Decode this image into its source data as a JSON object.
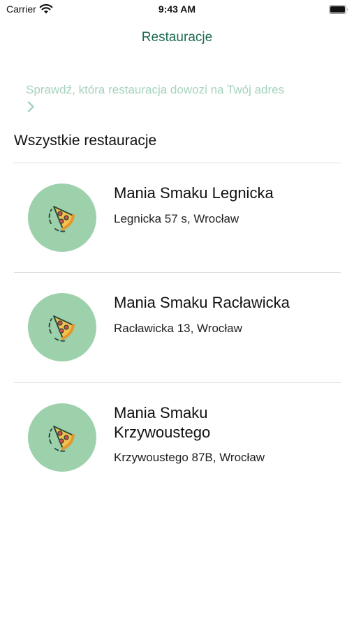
{
  "status_bar": {
    "carrier": "Carrier",
    "time": "9:43 AM"
  },
  "nav": {
    "title": "Restauracje"
  },
  "address_link": {
    "text": "Sprawdź, która restauracja dowozi na Twój adres"
  },
  "section": {
    "header": "Wszystkie restauracje"
  },
  "restaurants": [
    {
      "name": "Mania Smaku Legnicka",
      "address": "Legnicka 57 s, Wrocław",
      "icon": "pizza-icon"
    },
    {
      "name": "Mania Smaku Racławicka",
      "address": "Racławicka 13, Wrocław",
      "icon": "pizza-icon"
    },
    {
      "name": "Mania Smaku Krzywoustego",
      "address": "Krzywoustego 87B, Wrocław",
      "icon": "pizza-icon"
    }
  ],
  "colors": {
    "accent": "#1e6a50",
    "link": "#a6d3bd",
    "avatar_bg": "#9dd1ac"
  }
}
